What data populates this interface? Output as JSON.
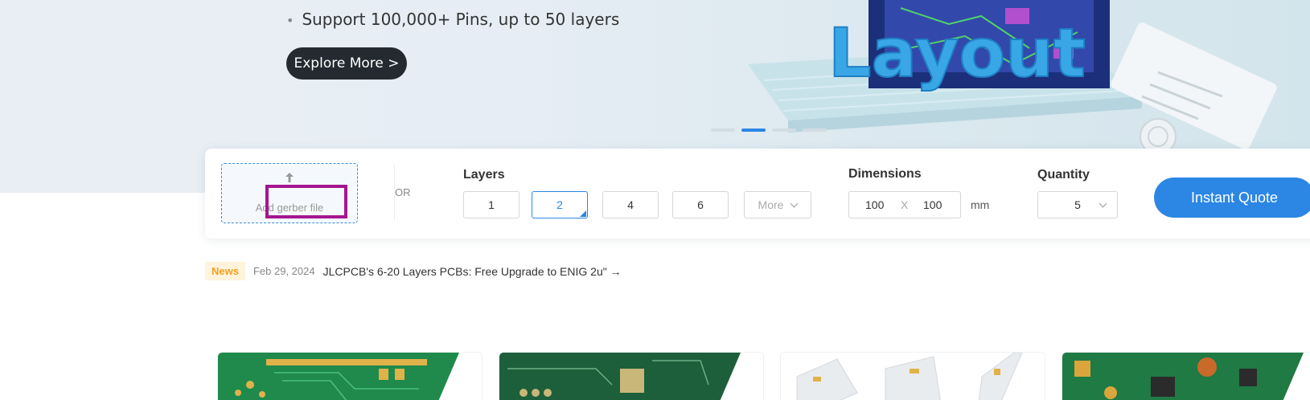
{
  "hero": {
    "bullet": "Support 100,000+ Pins, up to 50 layers",
    "explore_label": "Explore More >",
    "art_text": "Layout"
  },
  "quote": {
    "upload_label": "Add gerber file",
    "or_label": "OR",
    "layers": {
      "title": "Layers",
      "options": [
        "1",
        "2",
        "4",
        "6"
      ],
      "selected": "2",
      "more_label": "More"
    },
    "dimensions": {
      "title": "Dimensions",
      "width": "100",
      "separator": "X",
      "height": "100",
      "unit": "mm"
    },
    "quantity": {
      "title": "Quantity",
      "value": "5"
    },
    "submit_label": "Instant Quote"
  },
  "news": {
    "badge": "News",
    "date": "Feb 29, 2024",
    "text": "JLCPCB's 6-20 Layers PCBs: Free Upgrade to ENIG 2u\" →"
  },
  "colors": {
    "accent": "#2c86e4",
    "highlight": "#a5168f",
    "news_badge": "#f4a020",
    "dark_button": "#252a30"
  }
}
